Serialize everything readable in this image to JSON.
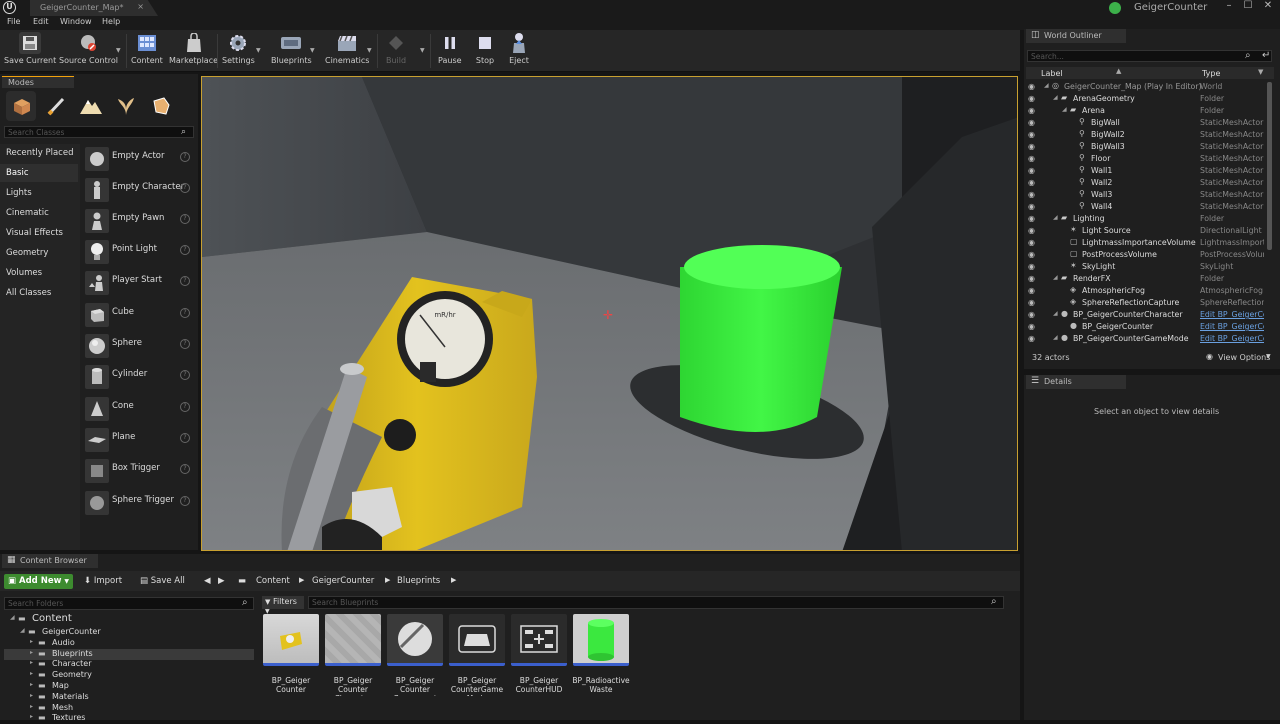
{
  "window": {
    "doc_tab": "GeigerCounter_Map*",
    "project": "GeigerCounter",
    "minimize": "–",
    "maximize": "☐",
    "close": "✕",
    "tab_close": "×"
  },
  "menu": [
    "File",
    "Edit",
    "Window",
    "Help"
  ],
  "toolbar": {
    "save_current": "Save Current",
    "source_control": "Source Control",
    "content": "Content",
    "marketplace": "Marketplace",
    "settings": "Settings",
    "blueprints": "Blueprints",
    "cinematics": "Cinematics",
    "build": "Build",
    "pause": "Pause",
    "stop": "Stop",
    "eject": "Eject"
  },
  "modes": {
    "tab": "Modes",
    "search_placeholder": "Search Classes",
    "categories": [
      "Recently Placed",
      "Basic",
      "Lights",
      "Cinematic",
      "Visual Effects",
      "Geometry",
      "Volumes",
      "All Classes"
    ],
    "selected_category": "Basic",
    "items": [
      "Empty Actor",
      "Empty Character",
      "Empty Pawn",
      "Point Light",
      "Player Start",
      "Cube",
      "Sphere",
      "Cylinder",
      "Cone",
      "Plane",
      "Box Trigger",
      "Sphere Trigger"
    ]
  },
  "viewport": {
    "meter_label": "mR/hr",
    "accent_object_color": "#35e83a",
    "meter_color": "#e3c21e"
  },
  "outliner": {
    "tab": "World Outliner",
    "search_placeholder": "Search...",
    "col_label": "Label",
    "col_type": "Type",
    "rows": [
      {
        "label": "GeigerCounter_Map (Play In Editor)",
        "type": "World",
        "depth": 0,
        "kind": "world"
      },
      {
        "label": "ArenaGeometry",
        "type": "Folder",
        "depth": 1,
        "kind": "folder"
      },
      {
        "label": "Arena",
        "type": "Folder",
        "depth": 2,
        "kind": "folder"
      },
      {
        "label": "BigWall",
        "type": "StaticMeshActor",
        "depth": 3,
        "kind": "mesh"
      },
      {
        "label": "BigWall2",
        "type": "StaticMeshActor",
        "depth": 3,
        "kind": "mesh"
      },
      {
        "label": "BigWall3",
        "type": "StaticMeshActor",
        "depth": 3,
        "kind": "mesh"
      },
      {
        "label": "Floor",
        "type": "StaticMeshActor",
        "depth": 3,
        "kind": "mesh"
      },
      {
        "label": "Wall1",
        "type": "StaticMeshActor",
        "depth": 3,
        "kind": "mesh"
      },
      {
        "label": "Wall2",
        "type": "StaticMeshActor",
        "depth": 3,
        "kind": "mesh"
      },
      {
        "label": "Wall3",
        "type": "StaticMeshActor",
        "depth": 3,
        "kind": "mesh"
      },
      {
        "label": "Wall4",
        "type": "StaticMeshActor",
        "depth": 3,
        "kind": "mesh"
      },
      {
        "label": "Lighting",
        "type": "Folder",
        "depth": 1,
        "kind": "folder"
      },
      {
        "label": "Light Source",
        "type": "DirectionalLight",
        "depth": 2,
        "kind": "light"
      },
      {
        "label": "LightmassImportanceVolume",
        "type": "LightmassImportanceVolume",
        "depth": 2,
        "kind": "volume"
      },
      {
        "label": "PostProcessVolume",
        "type": "PostProcessVolume",
        "depth": 2,
        "kind": "volume"
      },
      {
        "label": "SkyLight",
        "type": "SkyLight",
        "depth": 2,
        "kind": "light"
      },
      {
        "label": "RenderFX",
        "type": "Folder",
        "depth": 1,
        "kind": "folder"
      },
      {
        "label": "AtmosphericFog",
        "type": "AtmosphericFog",
        "depth": 2,
        "kind": "fx"
      },
      {
        "label": "SphereReflectionCapture",
        "type": "SphereReflectionCapture",
        "depth": 2,
        "kind": "fx"
      },
      {
        "label": "BP_GeigerCounterCharacter",
        "type": "Edit BP_GeigerCounterCharacter",
        "depth": 1,
        "kind": "bp"
      },
      {
        "label": "BP_GeigerCounter",
        "type": "Edit BP_GeigerCounter",
        "depth": 2,
        "kind": "bp"
      },
      {
        "label": "BP_GeigerCounterGameMode",
        "type": "Edit BP_GeigerCounterGameMode",
        "depth": 1,
        "kind": "bp"
      }
    ],
    "actor_count": "32 actors",
    "view_options": "View Options"
  },
  "details": {
    "tab": "Details",
    "empty_message": "Select an object to view details"
  },
  "content_browser": {
    "tab": "Content Browser",
    "add_new": "Add New",
    "import": "Import",
    "save_all": "Save All",
    "breadcrumbs": [
      "Content",
      "GeigerCounter",
      "Blueprints"
    ],
    "folder_search_placeholder": "Search Folders",
    "filters": "Filters",
    "bp_search_placeholder": "Search Blueprints",
    "folders": [
      {
        "name": "Content",
        "depth": 0
      },
      {
        "name": "GeigerCounter",
        "depth": 1
      },
      {
        "name": "Audio",
        "depth": 2
      },
      {
        "name": "Blueprints",
        "depth": 2,
        "selected": true
      },
      {
        "name": "Character",
        "depth": 2
      },
      {
        "name": "Geometry",
        "depth": 2
      },
      {
        "name": "Map",
        "depth": 2
      },
      {
        "name": "Materials",
        "depth": 2
      },
      {
        "name": "Mesh",
        "depth": 2
      },
      {
        "name": "Textures",
        "depth": 2
      }
    ],
    "assets": [
      {
        "name": "BP_Geiger Counter",
        "thumb": "geiger-thumbnail"
      },
      {
        "name": "BP_Geiger Counter Character",
        "thumb": "character-thumbnail"
      },
      {
        "name": "BP_Geiger Counter Component",
        "thumb": "component-thumbnail"
      },
      {
        "name": "BP_Geiger CounterGame Mode",
        "thumb": "gamepad-icon"
      },
      {
        "name": "BP_Geiger CounterHUD",
        "thumb": "hud-icon"
      },
      {
        "name": "BP_Radioactive Waste",
        "thumb": "barrel-thumbnail"
      }
    ]
  }
}
